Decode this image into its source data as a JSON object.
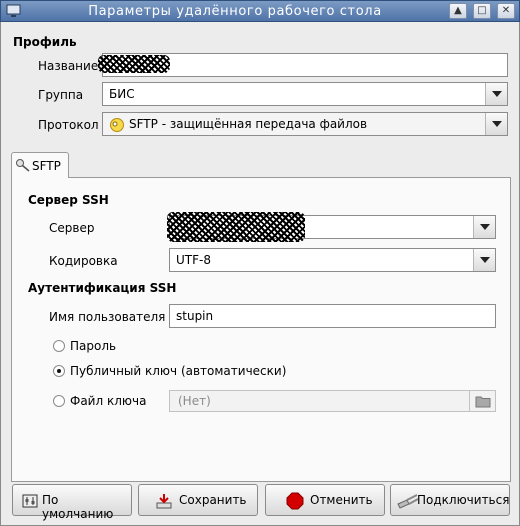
{
  "window": {
    "title": "Параметры удалённого рабочего стола"
  },
  "titlebar_buttons": {
    "up": "^",
    "maximize": "□",
    "close": "✕"
  },
  "profile": {
    "section": "Профиль",
    "name_label": "Название",
    "name_value": "",
    "group_label": "Группа",
    "group_value": "БИС",
    "protocol_label": "Протокол",
    "protocol_value": "SFTP - защищённая передача файлов"
  },
  "tabs": [
    {
      "label": "SFTP"
    }
  ],
  "ssh_server": {
    "section": "Сервер SSH",
    "server_label": "Сервер",
    "server_value": "",
    "encoding_label": "Кодировка",
    "encoding_value": "UTF-8"
  },
  "ssh_auth": {
    "section": "Аутентификация SSH",
    "username_label": "Имя пользователя",
    "username_value": "stupin",
    "options": [
      {
        "label": "Пароль",
        "selected": false
      },
      {
        "label": "Публичный ключ (автоматически)",
        "selected": true
      },
      {
        "label": "Файл ключа",
        "selected": false
      }
    ],
    "keyfile_value": "(Нет)"
  },
  "buttons": {
    "default": "По умолчанию",
    "save": "Сохранить",
    "cancel": "Отменить",
    "connect": "Подключиться"
  },
  "colors": {
    "titlebar": "#5a7db0",
    "cancel_icon": "#d40000"
  }
}
